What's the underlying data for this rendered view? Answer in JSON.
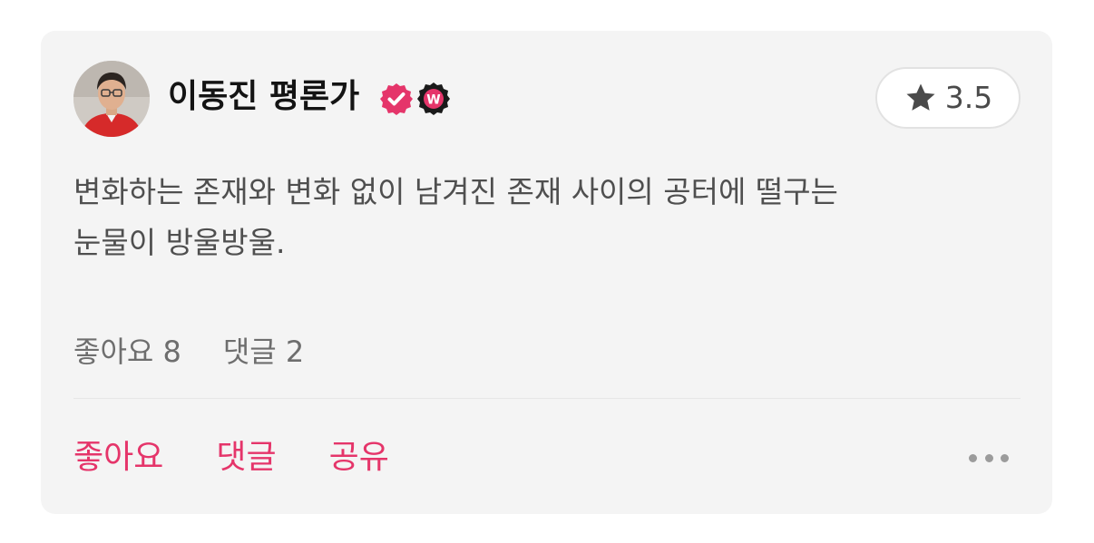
{
  "review": {
    "author": {
      "name": "이동진 평론가",
      "avatar_icon": "person-avatar",
      "badges": [
        "verified-check-icon",
        "watcha-w-badge-icon"
      ],
      "badge_w_letter": "W"
    },
    "rating": {
      "icon": "star-icon",
      "value": "3.5"
    },
    "text_line1": "변화하는 존재와 변화 없이 남겨진 존재 사이의 공터에 떨구는",
    "text_line2": "눈물이 방울방울.",
    "stats": {
      "likes": "좋아요 8",
      "comments": "댓글 2"
    },
    "actions": {
      "like": "좋아요",
      "comment": "댓글",
      "share": "공유",
      "more_icon": "more-horizontal-icon"
    }
  },
  "colors": {
    "accent": "#e5356a",
    "card_bg": "#f4f4f4",
    "text": "#4f4f4f",
    "badge_dark": "#1a1a1a"
  }
}
